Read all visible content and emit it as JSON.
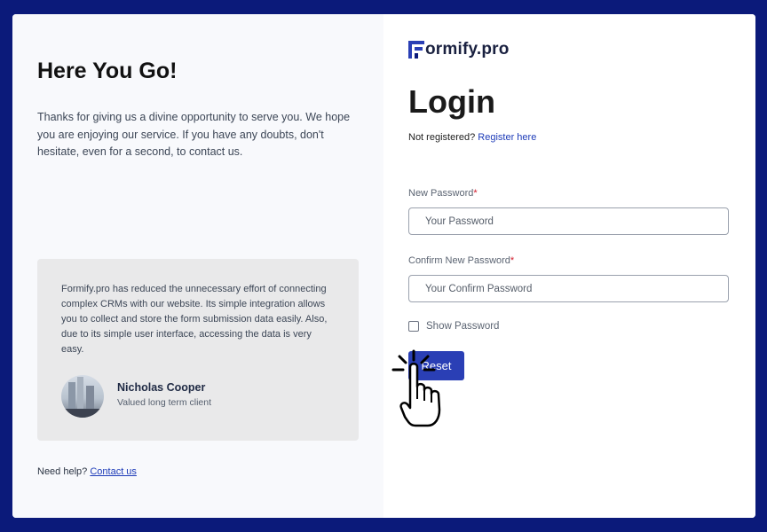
{
  "left": {
    "heading": "Here You Go!",
    "intro": "Thanks for giving us a divine opportunity to serve you. We hope you are enjoying our service. If you have any doubts, don't hesitate, even for a second, to contact us.",
    "testimonial": {
      "quote": "Formify.pro has reduced the unnecessary effort of connecting complex CRMs with our website. Its simple integration allows you to collect and store the form submission data easily. Also, due to its simple user interface, accessing the data is very easy.",
      "name": "Nicholas Cooper",
      "role": "Valued long term client"
    },
    "help_text": "Need help?",
    "help_link": "Contact us"
  },
  "right": {
    "logo_text": "ormify.pro",
    "title": "Login",
    "register_prefix": "Not registered?",
    "register_link": "Register here",
    "new_password_label": "New Password",
    "new_password_placeholder": "Your Password",
    "confirm_password_label": "Confirm New Password",
    "confirm_password_placeholder": "Your Confirm Password",
    "required_mark": "*",
    "show_password_label": "Show Password",
    "show_password_checked": false,
    "reset_label": "Reset"
  },
  "colors": {
    "background": "#0b1a7a",
    "accent": "#2a3fb5",
    "link": "#1d3bb8",
    "required": "#d11a2a"
  },
  "icons": [
    "formify-logo-icon",
    "hand-pointer-cursor-icon",
    "avatar-photo"
  ]
}
